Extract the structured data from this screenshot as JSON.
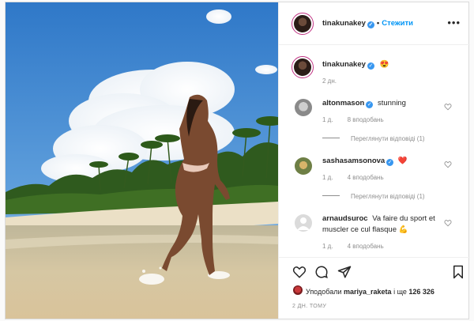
{
  "header": {
    "username": "tinakunakey",
    "follow_label": "Стежити",
    "more_icon": "more-horizontal-icon"
  },
  "caption": {
    "username": "tinakunakey",
    "emoji": "😍",
    "time": "2 дн."
  },
  "comments": [
    {
      "username": "altonmason",
      "verified": true,
      "text": "stunning",
      "time": "1 д.",
      "likes": "8 вподобань",
      "replies": "Переглянути відповіді (1)"
    },
    {
      "username": "sashasamsonova",
      "verified": true,
      "text": "❤️",
      "time": "1 д.",
      "likes": "4 вподобань",
      "replies": "Переглянути відповіді (1)"
    },
    {
      "username": "arnaudsuroc",
      "verified": false,
      "text": "Va faire du sport et muscler ce cul flasque 💪",
      "time": "1 д.",
      "likes": "4 вподобань"
    }
  ],
  "actions": {
    "liked_prefix": "Уподобали",
    "liked_user": "mariya_raketa",
    "liked_middle": "і ще",
    "liked_count": "126 326",
    "posted": "2 ДН. ТОМУ"
  },
  "colors": {
    "accent": "#0095f6",
    "verified": "#3897f0",
    "heart": "#ed4956",
    "muted": "#8e8e8e"
  }
}
